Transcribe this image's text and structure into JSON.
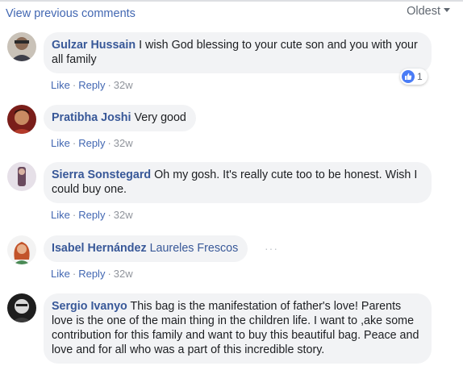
{
  "header": {
    "view_previous": "View previous comments",
    "sort_label": "Oldest"
  },
  "comments": [
    {
      "author": "Gulzar Hussain",
      "text": "I wish God blessing to your cute son and you with your all family",
      "actions": {
        "like": "Like",
        "reply": "Reply",
        "time": "32w"
      },
      "reaction_count": "1"
    },
    {
      "author": "Pratibha Joshi",
      "text": "Very good",
      "actions": {
        "like": "Like",
        "reply": "Reply",
        "time": "32w"
      }
    },
    {
      "author": "Sierra Sonstegard",
      "text": "Oh my gosh. It's really cute too to be honest. Wish I could buy one.",
      "actions": {
        "like": "Like",
        "reply": "Reply",
        "time": "32w"
      }
    },
    {
      "author": "Isabel Hernández",
      "tagged": "Laureles Frescos",
      "actions": {
        "like": "Like",
        "reply": "Reply",
        "time": "32w"
      }
    },
    {
      "author": "Sergio Ivanyo",
      "text": "This bag is the manifestation of father's love! Parents love is the one of the main thing in the children life. I want to ,ake some contribution for this family and want to buy this beautiful bag. Peace and love and for all who was a part of this incredible story."
    }
  ],
  "colors": {
    "link": "#4267b2",
    "author": "#385898",
    "bubble": "#f2f3f5",
    "meta": "#90949c",
    "like_blue": "#4a7cf6"
  },
  "icons": {
    "reaction": "like-thumb-icon",
    "sort": "caret-down-icon",
    "more": "more-options-icon"
  }
}
